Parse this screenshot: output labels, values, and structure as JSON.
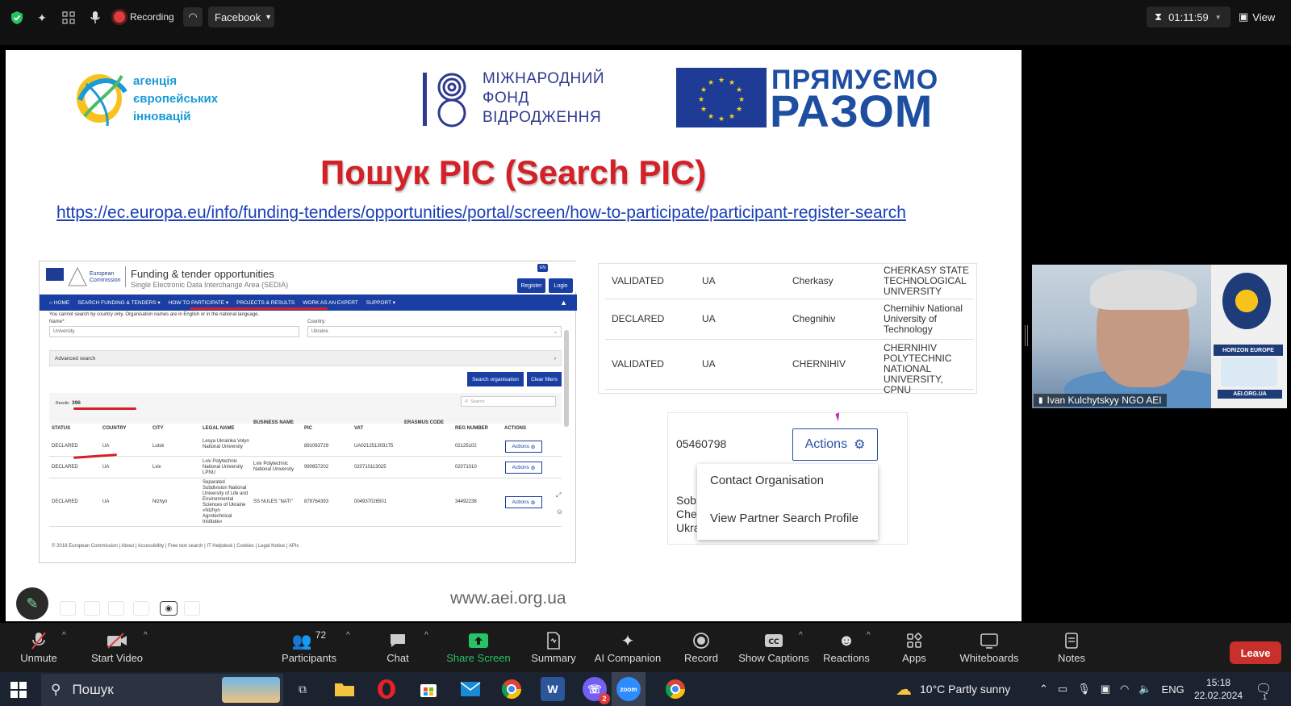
{
  "topbar": {
    "recording_label": "Recording",
    "source_label": "Facebook",
    "timer": "01:11:59",
    "view_label": "View"
  },
  "slide": {
    "aei_logo_lines": [
      "агенція",
      "європейських",
      "інновацій"
    ],
    "irf_logo_lines": [
      "МІЖНАРОДНИЙ",
      "ФОНД",
      "ВІДРОДЖЕННЯ"
    ],
    "pr_line1": "ПРЯМУЄМО",
    "pr_line2": "РАЗОМ",
    "title": "Пошук PIC (Search PIC)",
    "url": "https://ec.europa.eu/info/funding-tenders/opportunities/portal/screen/how-to-participate/participant-register-search",
    "footer": "www.aei.org.ua"
  },
  "portal": {
    "ec_line1": "European",
    "ec_line2": "Commission",
    "title": "Funding & tender opportunities",
    "subtitle": "Single Electronic Data Interchange Area (SEDIA)",
    "lang": "EN",
    "register": "Register",
    "login": "Login",
    "nav": [
      "HOME",
      "SEARCH FUNDING & TENDERS ▾",
      "HOW TO PARTICIPATE ▾",
      "PROJECTS & RESULTS",
      "WORK AS AN EXPERT",
      "SUPPORT ▾"
    ],
    "note": "You cannot search by country only. Organisation names are in English or in the national language.",
    "name_label": "Name*:",
    "name_value": "University",
    "country_label": "Country:",
    "country_value": "Ukraine",
    "advanced": "Advanced search",
    "search_btn": "Search organisation",
    "clear_btn": "Clear filters",
    "results_label": "Results",
    "results_count": "396",
    "search_placeholder": "Search",
    "columns": [
      "STATUS",
      "COUNTRY",
      "CITY",
      "LEGAL NAME",
      "BUSINESS NAME",
      "PIC",
      "VAT",
      "ERASMUS CODE",
      "REG NUMBER",
      "ACTIONS"
    ],
    "rows": [
      {
        "status": "DECLARED",
        "country": "UA",
        "city": "Lutsk",
        "legal": "Lesya Ukrainka Volyn National University",
        "business": "",
        "pic": "891063729",
        "vat": "UA021251303175",
        "reg": "02125102"
      },
      {
        "status": "DECLARED",
        "country": "UA",
        "city": "Lviv",
        "legal": "Lviv Polytechnic National University LPNU",
        "business": "Lviv Polytechnic National University",
        "pic": "990657202",
        "vat": "020710113025",
        "reg": "02071010"
      },
      {
        "status": "DECLARED",
        "country": "UA",
        "city": "Nizhyn",
        "legal": "Separated Subdivision National University of Life and Environmental Sciences of Ukraine «Nizhyn Agrotechnical Institute»",
        "business": "SS NULES \"NATI\"",
        "pic": "878764393",
        "vat": "004937026501",
        "reg": "34492238"
      }
    ],
    "actions_label": "Actions",
    "footer": "© 2018 European Commission | About | Accessibility | Free text search | IT Helpdesk | Cookies | Legal Notice | APIs"
  },
  "right_table": [
    {
      "status": "VALIDATED",
      "country": "UA",
      "city": "Cherkasy",
      "name": "CHERKASY STATE TECHNOLOGICAL UNIVERSITY"
    },
    {
      "status": "DECLARED",
      "country": "UA",
      "city": "Chegnihiv",
      "name": "Chernihiv National University of Technology"
    },
    {
      "status": "VALIDATED",
      "country": "UA",
      "city": "CHERNIHIV",
      "name": "CHERNIHIV POLYTECHNIC NATIONAL UNIVERSITY, CPNU"
    }
  ],
  "actions_crop": {
    "pic": "05460798",
    "button": "Actions",
    "menu": [
      "Contact Organisation",
      "View Partner Search Profile"
    ],
    "partial_text": [
      "Sob",
      "Che",
      "Ukra"
    ]
  },
  "video": {
    "participant_name": "Ivan Kulchytskyy NGO AEI",
    "poster_label": "HORIZON EUROPE",
    "poster_url": "AEI.ORG.UA"
  },
  "toolbar": {
    "unmute": "Unmute",
    "start_video": "Start Video",
    "participants": "Participants",
    "participants_count": "72",
    "chat": "Chat",
    "share_screen": "Share Screen",
    "summary": "Summary",
    "ai_companion": "AI Companion",
    "record": "Record",
    "show_captions": "Show Captions",
    "reactions": "Reactions",
    "apps": "Apps",
    "whiteboards": "Whiteboards",
    "notes": "Notes",
    "leave": "Leave"
  },
  "taskbar": {
    "search": "Пошук",
    "weather": "10°C  Partly sunny",
    "lang": "ENG",
    "time": "15:18",
    "date": "22.02.2024",
    "viber_badge": "2",
    "notif_count": "1"
  },
  "colors": {
    "slide_title": "#d42027",
    "brand_blue": "#1a3fa3",
    "leave_red": "#c9302c",
    "share_green": "#27c265"
  }
}
